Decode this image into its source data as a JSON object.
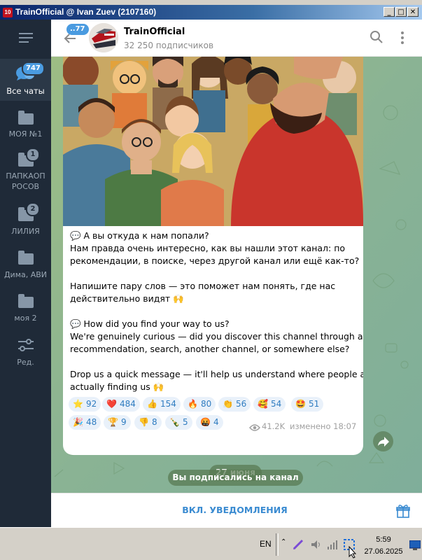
{
  "window": {
    "title": "TrainOfficial @ Ivan Zuev (2107160)",
    "app_icon_text": "10"
  },
  "sidebar": {
    "menu_icon": "hamburger-icon",
    "items": [
      {
        "label": "Все чаты",
        "badge": "747",
        "icon": "chat-bubbles-icon",
        "active": true
      },
      {
        "label": "МОЯ №1",
        "badge": "",
        "icon": "folder-icon"
      },
      {
        "label": "ПАПКАОП РОСОВ",
        "label_lines": [
          "ПАПКАОП",
          "РОСОВ"
        ],
        "badge": "1",
        "icon": "folder-icon"
      },
      {
        "label": "ЛИЛИЯ",
        "badge": "2",
        "icon": "folder-icon"
      },
      {
        "label": "Дима, АВИ",
        "badge": "",
        "icon": "folder-icon"
      },
      {
        "label": "моя 2",
        "badge": "",
        "icon": "folder-icon"
      },
      {
        "label": "Ред.",
        "badge": "",
        "icon": "sliders-icon"
      }
    ]
  },
  "header": {
    "back_badge": "..77",
    "channel_name": "TrainOfficial",
    "subscribers": "32 250 подписчиков"
  },
  "post": {
    "lines": [
      "💬 А вы откуда к нам попали?",
      "Нам правда очень интересно, как вы нашли этот канал: по",
      "рекомендации, в поиске, через другой канал или ещё как-то?",
      "",
      "Напишите пару слов — это поможет нам понять, где нас",
      "действительно видят 🙌",
      "",
      "💬 How did you find your way to us?",
      "We're genuinely curious — did you discover this channel through a",
      "recommendation, search, another channel, or somewhere else?",
      "",
      "Drop us a quick message — it'll help us understand where people are",
      "actually finding us 🙌"
    ],
    "reactions": [
      {
        "emoji": "⭐",
        "count": "92"
      },
      {
        "emoji": "❤️",
        "count": "484"
      },
      {
        "emoji": "👍",
        "count": "154"
      },
      {
        "emoji": "🔥",
        "count": "80"
      },
      {
        "emoji": "👏",
        "count": "56"
      },
      {
        "emoji": "🥰",
        "count": "54"
      },
      {
        "emoji": "🤩",
        "count": "51"
      },
      {
        "emoji": "🎉",
        "count": "48"
      },
      {
        "emoji": "🏆",
        "count": "9"
      },
      {
        "emoji": "👎",
        "count": "8"
      },
      {
        "emoji": "🍾",
        "count": "5"
      },
      {
        "emoji": "🤬",
        "count": "4"
      }
    ],
    "views": "41.2K",
    "edited_time": "изменено 18:07"
  },
  "service": {
    "date": "27 июня",
    "subscribed": "Вы подписались на канал"
  },
  "bottom": {
    "notify_label": "ВКЛ. УВЕДОМЛЕНИЯ"
  },
  "taskbar": {
    "lang": "EN",
    "time": "5:59",
    "date": "27.06.2025"
  },
  "colors": {
    "accent": "#3a8bd1",
    "sidebar_bg": "#1f2a38",
    "chat_bg": "#8fb38a",
    "reaction_bg": "#e9f1fa"
  }
}
